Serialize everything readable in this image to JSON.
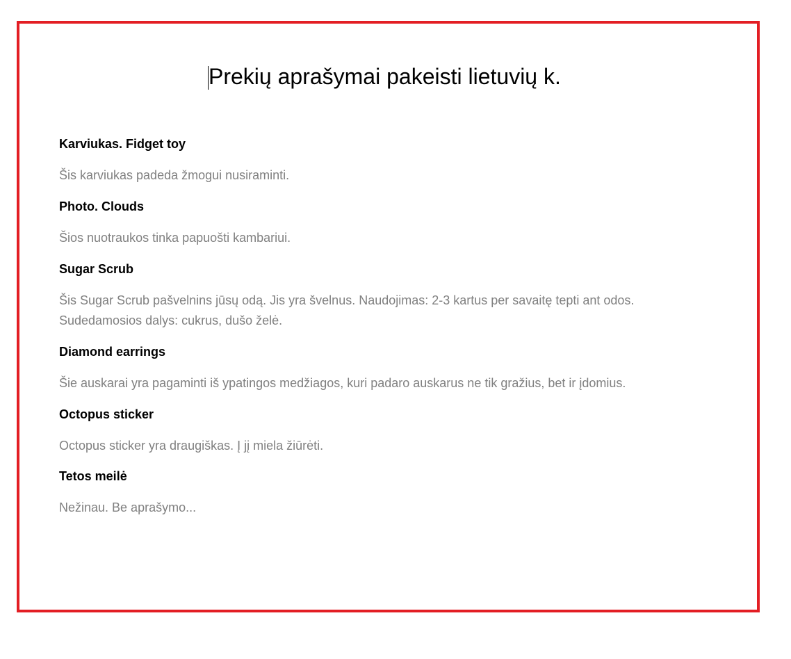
{
  "document": {
    "title": "Prekių aprašymai pakeisti lietuvių k.",
    "border_color": "#e31e24",
    "products": [
      {
        "name": "Karviukas. Fidget toy",
        "description": "Šis karviukas padeda žmogui nusiraminti."
      },
      {
        "name": "Photo. Clouds",
        "description": "Šios nuotraukos tinka papuošti kambariui."
      },
      {
        "name": "Sugar Scrub",
        "description": "Šis Sugar Scrub pašvelnins jūsų odą. Jis yra švelnus. Naudojimas: 2-3 kartus per savaitę tepti ant odos. Sudedamosios dalys: cukrus, dušo želė."
      },
      {
        "name": "Diamond earrings",
        "description": "Šie auskarai yra pagaminti iš ypatingos medžiagos, kuri padaro auskarus ne tik gražius, bet ir įdomius."
      },
      {
        "name": "Octopus sticker",
        "description": "Octopus sticker yra draugiškas. Į jį miela žiūrėti."
      },
      {
        "name": "Tetos meilė",
        "description": "Nežinau. Be aprašymo..."
      }
    ]
  }
}
